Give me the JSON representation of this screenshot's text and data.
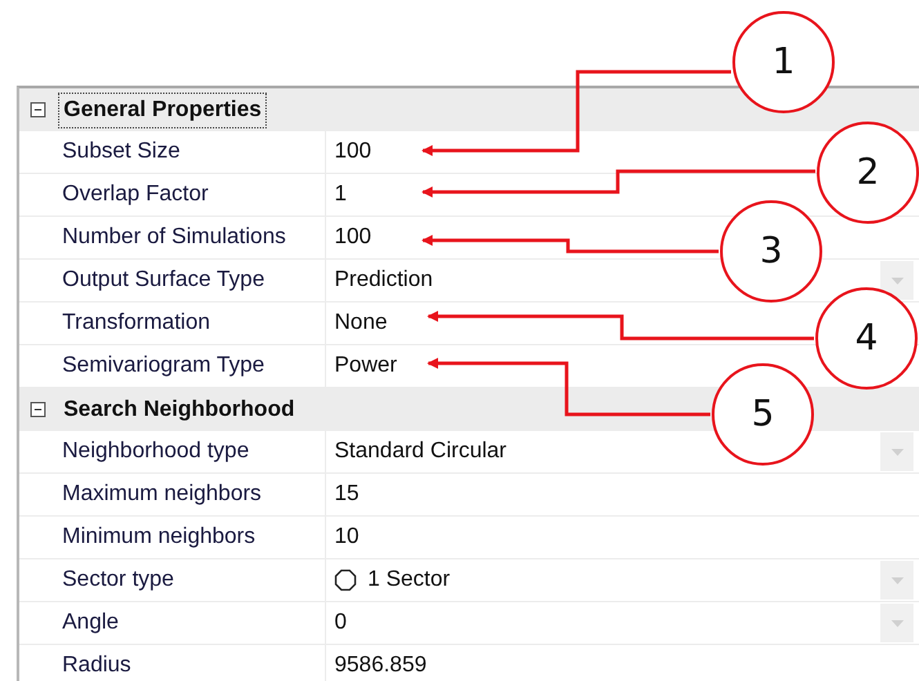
{
  "sections": [
    {
      "title": "General Properties",
      "expanded": true,
      "focused": true,
      "rows": [
        {
          "label": "Subset Size",
          "value": "100",
          "kind": "text"
        },
        {
          "label": "Overlap Factor",
          "value": "1",
          "kind": "text"
        },
        {
          "label": "Number of Simulations",
          "value": "100",
          "kind": "text"
        },
        {
          "label": "Output Surface Type",
          "value": "Prediction",
          "kind": "dropdown"
        },
        {
          "label": "Transformation",
          "value": "None",
          "kind": "text"
        },
        {
          "label": "Semivariogram Type",
          "value": "Power",
          "kind": "text"
        }
      ]
    },
    {
      "title": "Search Neighborhood",
      "expanded": true,
      "focused": false,
      "rows": [
        {
          "label": "Neighborhood type",
          "value": "Standard Circular",
          "kind": "dropdown"
        },
        {
          "label": "Maximum neighbors",
          "value": "15",
          "kind": "text"
        },
        {
          "label": "Minimum neighbors",
          "value": "10",
          "kind": "text"
        },
        {
          "label": "Sector type",
          "value": "1 Sector",
          "kind": "sector"
        },
        {
          "label": "Angle",
          "value": "0",
          "kind": "dropdown"
        },
        {
          "label": "Radius",
          "value": "9586.859",
          "kind": "text"
        }
      ]
    }
  ],
  "callouts": [
    {
      "label": "1"
    },
    {
      "label": "2"
    },
    {
      "label": "3"
    },
    {
      "label": "4"
    },
    {
      "label": "5"
    }
  ]
}
